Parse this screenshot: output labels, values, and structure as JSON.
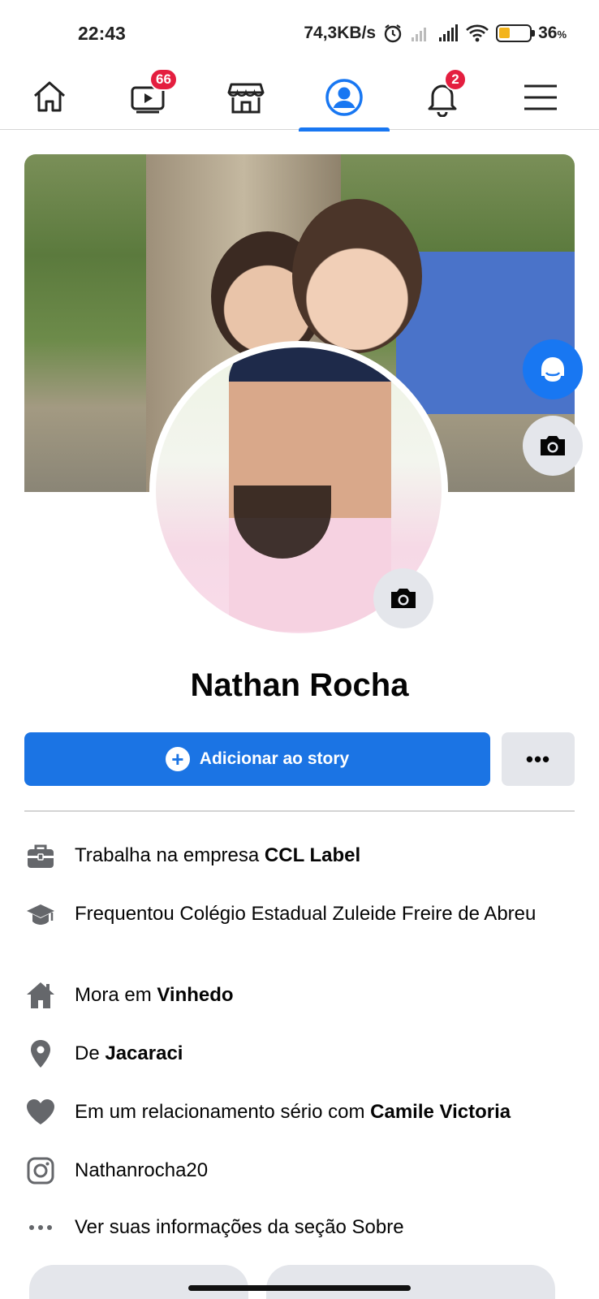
{
  "status_bar": {
    "time": "22:43",
    "network_speed": "74,3KB/s",
    "battery_percent": "36",
    "battery_unit": "%",
    "battery_level": 0.36,
    "icons": [
      "alarm-icon",
      "signal-weak-icon",
      "signal-icon",
      "wifi-icon",
      "battery-icon"
    ]
  },
  "nav": {
    "tabs": [
      {
        "name": "home",
        "icon": "home-icon",
        "badge": ""
      },
      {
        "name": "watch",
        "icon": "video-icon",
        "badge": "66"
      },
      {
        "name": "marketplace",
        "icon": "store-icon",
        "badge": ""
      },
      {
        "name": "profile",
        "icon": "profile-icon",
        "badge": "",
        "active": true
      },
      {
        "name": "notifications",
        "icon": "bell-icon",
        "badge": "2"
      },
      {
        "name": "menu",
        "icon": "hamburger-icon",
        "badge": ""
      }
    ],
    "accent_color": "#1877f2",
    "badge_color": "#e41e3f"
  },
  "profile": {
    "name": "Nathan Rocha",
    "add_story_label": "Adicionar ao story",
    "more_label": "•••"
  },
  "details": [
    {
      "icon": "briefcase-icon",
      "prefix": "Trabalha na empresa ",
      "bold": "CCL Label",
      "suffix": ""
    },
    {
      "icon": "graduation-cap-icon",
      "prefix": "Frequentou Colégio Estadual Zuleide Freire de Abreu",
      "bold": "",
      "suffix": ""
    },
    {
      "icon": "house-icon",
      "prefix": "Mora em ",
      "bold": "Vinhedo",
      "suffix": ""
    },
    {
      "icon": "location-pin-icon",
      "prefix": "De ",
      "bold": "Jacaraci",
      "suffix": ""
    },
    {
      "icon": "heart-icon",
      "prefix": "Em um relacionamento sério com ",
      "bold": "Camile Victoria",
      "suffix": ""
    },
    {
      "icon": "instagram-icon",
      "prefix": "Nathanrocha20",
      "bold": "",
      "suffix": ""
    },
    {
      "icon": "ellipsis-icon",
      "prefix": "Ver suas informações da seção Sobre",
      "bold": "",
      "suffix": ""
    }
  ]
}
